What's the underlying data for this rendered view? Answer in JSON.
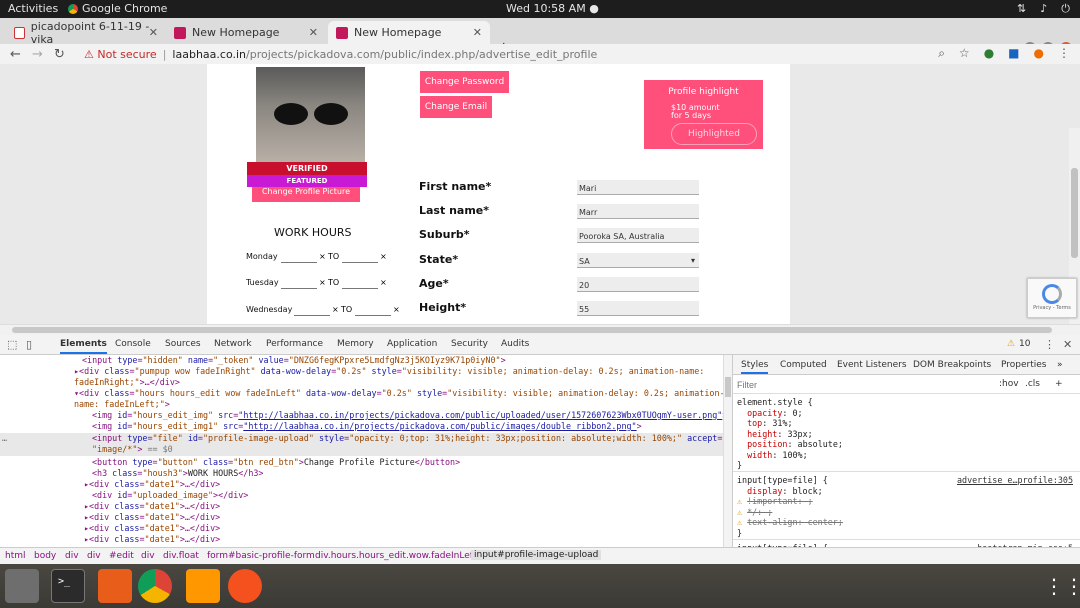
{
  "topbar": {
    "activities": "Activities",
    "app": "Google Chrome",
    "clock": "Wed 10:58 AM ●"
  },
  "tabs": [
    {
      "label": "picadopoint 6-11-19 - vika"
    },
    {
      "label": "New Homepage"
    },
    {
      "label": "New Homepage"
    }
  ],
  "address": {
    "security": "Not secure",
    "host": "laabhaa.co.in",
    "path": "/projects/pickadova.com/public/index.php/advertise_edit_profile"
  },
  "page": {
    "change_password": "Change Password",
    "change_email": "Change Email",
    "profile_highlight": "Profile highlight",
    "highlight_amount": "$10 amount",
    "highlight_days": "for 5 days",
    "highlighted": "Highlighted",
    "ribbon_verified": "VERIFIED",
    "ribbon_featured": "FEATURED",
    "change_picture": "Change Profile Picture",
    "work_hours": "WORK HOURS",
    "days": [
      {
        "day": "Monday"
      },
      {
        "day": "Tuesday"
      },
      {
        "day": "Wednesday"
      }
    ],
    "to": "TO",
    "x": "×",
    "fields": [
      {
        "label": "First name*",
        "value": "Mari"
      },
      {
        "label": "Last name*",
        "value": "Marr"
      },
      {
        "label": "Suburb*",
        "value": "Pooroka SA, Australia"
      },
      {
        "label": "State*",
        "value": "SA"
      },
      {
        "label": "Age*",
        "value": "20"
      },
      {
        "label": "Height*",
        "value": "55"
      }
    ],
    "recaptcha": "Privacy - Terms"
  },
  "devtools": {
    "tabs": [
      "Elements",
      "Console",
      "Sources",
      "Network",
      "Performance",
      "Memory",
      "Application",
      "Security",
      "Audits"
    ],
    "warnings": "10",
    "style_tabs": [
      "Styles",
      "Computed",
      "Event Listeners",
      "DOM Breakpoints",
      "Properties"
    ],
    "filter_placeholder": "Filter",
    "hov": ":hov",
    "cls": ".cls",
    "breadcrumbs": [
      "html",
      "body",
      "div",
      "div",
      "#edit",
      "div",
      "div.float",
      "form#basic-profile-form",
      "div.hours.hours_edit.wow.fadeInLeft",
      "input#profile-image-upload"
    ]
  },
  "colors": {
    "accent": "#ff4f7b",
    "devtools_blue": "#1a73e8"
  }
}
